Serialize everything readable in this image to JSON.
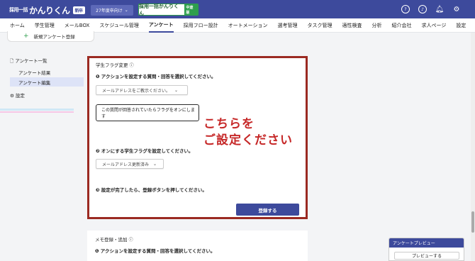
{
  "header": {
    "logo_small": "採用一括",
    "logo_big": "かんりくん",
    "logo_tag": "新卒",
    "year_select": "27年度卒向け",
    "subbrand": "採用一括かんりくん",
    "subbrand_tag": "中途版",
    "icons": [
      "help-icon",
      "headset-icon",
      "bell-icon",
      "settings-icon"
    ]
  },
  "nav": {
    "items": [
      "ホーム",
      "学生管理",
      "メールBOX",
      "スケジュール管理",
      "アンケート",
      "採用フロー設計",
      "オートメーション",
      "選考管理",
      "タスク管理",
      "適性検査",
      "分析",
      "紹介会社",
      "求人ページ",
      "設定"
    ],
    "active": "アンケート"
  },
  "sidebar": {
    "items": [
      {
        "label": "アンケート一覧"
      },
      {
        "label": "アンケート結果"
      },
      {
        "label": "アンケート編集"
      },
      {
        "label": "設定"
      }
    ]
  },
  "main": {
    "new_survey": "新規アンケート登録",
    "card": {
      "title": "学生フラグ変更",
      "step1": "❶ アクションを設定する質問・回答を選択してください。",
      "select1": "メールアドレスをご教示ください。",
      "tooltip": "この質問が回答されていたらフラグをオンにします",
      "step2": "❷ オンにする学生フラグを設定してください。",
      "select2": "メールアドレス更新済み",
      "step3": "❸ 設定が完了したら、登録ボタンを押してください。",
      "register": "登録する",
      "callout_1": "こちらを",
      "callout_2": "ご設定ください"
    },
    "memo": {
      "title": "メモ登録・追加",
      "step1": "❶ アクションを設定する質問・回答を選択してください。"
    }
  },
  "preview": {
    "title": "アンケートプレビュー",
    "button": "プレビューする"
  },
  "colors": {
    "primary": "#3d4a9c",
    "accent_green": "#2e9e4d",
    "highlight_border": "#9b2a22",
    "callout_text": "#c62828"
  }
}
